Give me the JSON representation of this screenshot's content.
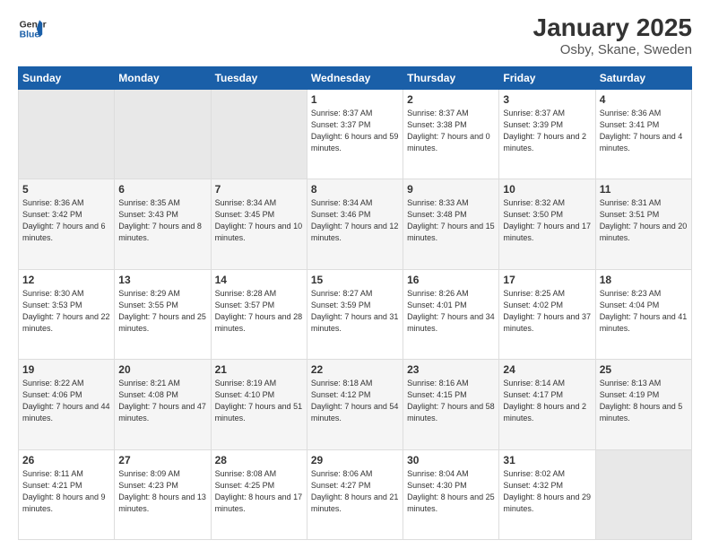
{
  "logo": {
    "line1": "General",
    "line2": "Blue"
  },
  "title": "January 2025",
  "subtitle": "Osby, Skane, Sweden",
  "days_header": [
    "Sunday",
    "Monday",
    "Tuesday",
    "Wednesday",
    "Thursday",
    "Friday",
    "Saturday"
  ],
  "weeks": [
    [
      {
        "num": "",
        "info": ""
      },
      {
        "num": "",
        "info": ""
      },
      {
        "num": "",
        "info": ""
      },
      {
        "num": "1",
        "info": "Sunrise: 8:37 AM\nSunset: 3:37 PM\nDaylight: 6 hours\nand 59 minutes."
      },
      {
        "num": "2",
        "info": "Sunrise: 8:37 AM\nSunset: 3:38 PM\nDaylight: 7 hours\nand 0 minutes."
      },
      {
        "num": "3",
        "info": "Sunrise: 8:37 AM\nSunset: 3:39 PM\nDaylight: 7 hours\nand 2 minutes."
      },
      {
        "num": "4",
        "info": "Sunrise: 8:36 AM\nSunset: 3:41 PM\nDaylight: 7 hours\nand 4 minutes."
      }
    ],
    [
      {
        "num": "5",
        "info": "Sunrise: 8:36 AM\nSunset: 3:42 PM\nDaylight: 7 hours\nand 6 minutes."
      },
      {
        "num": "6",
        "info": "Sunrise: 8:35 AM\nSunset: 3:43 PM\nDaylight: 7 hours\nand 8 minutes."
      },
      {
        "num": "7",
        "info": "Sunrise: 8:34 AM\nSunset: 3:45 PM\nDaylight: 7 hours\nand 10 minutes."
      },
      {
        "num": "8",
        "info": "Sunrise: 8:34 AM\nSunset: 3:46 PM\nDaylight: 7 hours\nand 12 minutes."
      },
      {
        "num": "9",
        "info": "Sunrise: 8:33 AM\nSunset: 3:48 PM\nDaylight: 7 hours\nand 15 minutes."
      },
      {
        "num": "10",
        "info": "Sunrise: 8:32 AM\nSunset: 3:50 PM\nDaylight: 7 hours\nand 17 minutes."
      },
      {
        "num": "11",
        "info": "Sunrise: 8:31 AM\nSunset: 3:51 PM\nDaylight: 7 hours\nand 20 minutes."
      }
    ],
    [
      {
        "num": "12",
        "info": "Sunrise: 8:30 AM\nSunset: 3:53 PM\nDaylight: 7 hours\nand 22 minutes."
      },
      {
        "num": "13",
        "info": "Sunrise: 8:29 AM\nSunset: 3:55 PM\nDaylight: 7 hours\nand 25 minutes."
      },
      {
        "num": "14",
        "info": "Sunrise: 8:28 AM\nSunset: 3:57 PM\nDaylight: 7 hours\nand 28 minutes."
      },
      {
        "num": "15",
        "info": "Sunrise: 8:27 AM\nSunset: 3:59 PM\nDaylight: 7 hours\nand 31 minutes."
      },
      {
        "num": "16",
        "info": "Sunrise: 8:26 AM\nSunset: 4:01 PM\nDaylight: 7 hours\nand 34 minutes."
      },
      {
        "num": "17",
        "info": "Sunrise: 8:25 AM\nSunset: 4:02 PM\nDaylight: 7 hours\nand 37 minutes."
      },
      {
        "num": "18",
        "info": "Sunrise: 8:23 AM\nSunset: 4:04 PM\nDaylight: 7 hours\nand 41 minutes."
      }
    ],
    [
      {
        "num": "19",
        "info": "Sunrise: 8:22 AM\nSunset: 4:06 PM\nDaylight: 7 hours\nand 44 minutes."
      },
      {
        "num": "20",
        "info": "Sunrise: 8:21 AM\nSunset: 4:08 PM\nDaylight: 7 hours\nand 47 minutes."
      },
      {
        "num": "21",
        "info": "Sunrise: 8:19 AM\nSunset: 4:10 PM\nDaylight: 7 hours\nand 51 minutes."
      },
      {
        "num": "22",
        "info": "Sunrise: 8:18 AM\nSunset: 4:12 PM\nDaylight: 7 hours\nand 54 minutes."
      },
      {
        "num": "23",
        "info": "Sunrise: 8:16 AM\nSunset: 4:15 PM\nDaylight: 7 hours\nand 58 minutes."
      },
      {
        "num": "24",
        "info": "Sunrise: 8:14 AM\nSunset: 4:17 PM\nDaylight: 8 hours\nand 2 minutes."
      },
      {
        "num": "25",
        "info": "Sunrise: 8:13 AM\nSunset: 4:19 PM\nDaylight: 8 hours\nand 5 minutes."
      }
    ],
    [
      {
        "num": "26",
        "info": "Sunrise: 8:11 AM\nSunset: 4:21 PM\nDaylight: 8 hours\nand 9 minutes."
      },
      {
        "num": "27",
        "info": "Sunrise: 8:09 AM\nSunset: 4:23 PM\nDaylight: 8 hours\nand 13 minutes."
      },
      {
        "num": "28",
        "info": "Sunrise: 8:08 AM\nSunset: 4:25 PM\nDaylight: 8 hours\nand 17 minutes."
      },
      {
        "num": "29",
        "info": "Sunrise: 8:06 AM\nSunset: 4:27 PM\nDaylight: 8 hours\nand 21 minutes."
      },
      {
        "num": "30",
        "info": "Sunrise: 8:04 AM\nSunset: 4:30 PM\nDaylight: 8 hours\nand 25 minutes."
      },
      {
        "num": "31",
        "info": "Sunrise: 8:02 AM\nSunset: 4:32 PM\nDaylight: 8 hours\nand 29 minutes."
      },
      {
        "num": "",
        "info": ""
      }
    ]
  ]
}
